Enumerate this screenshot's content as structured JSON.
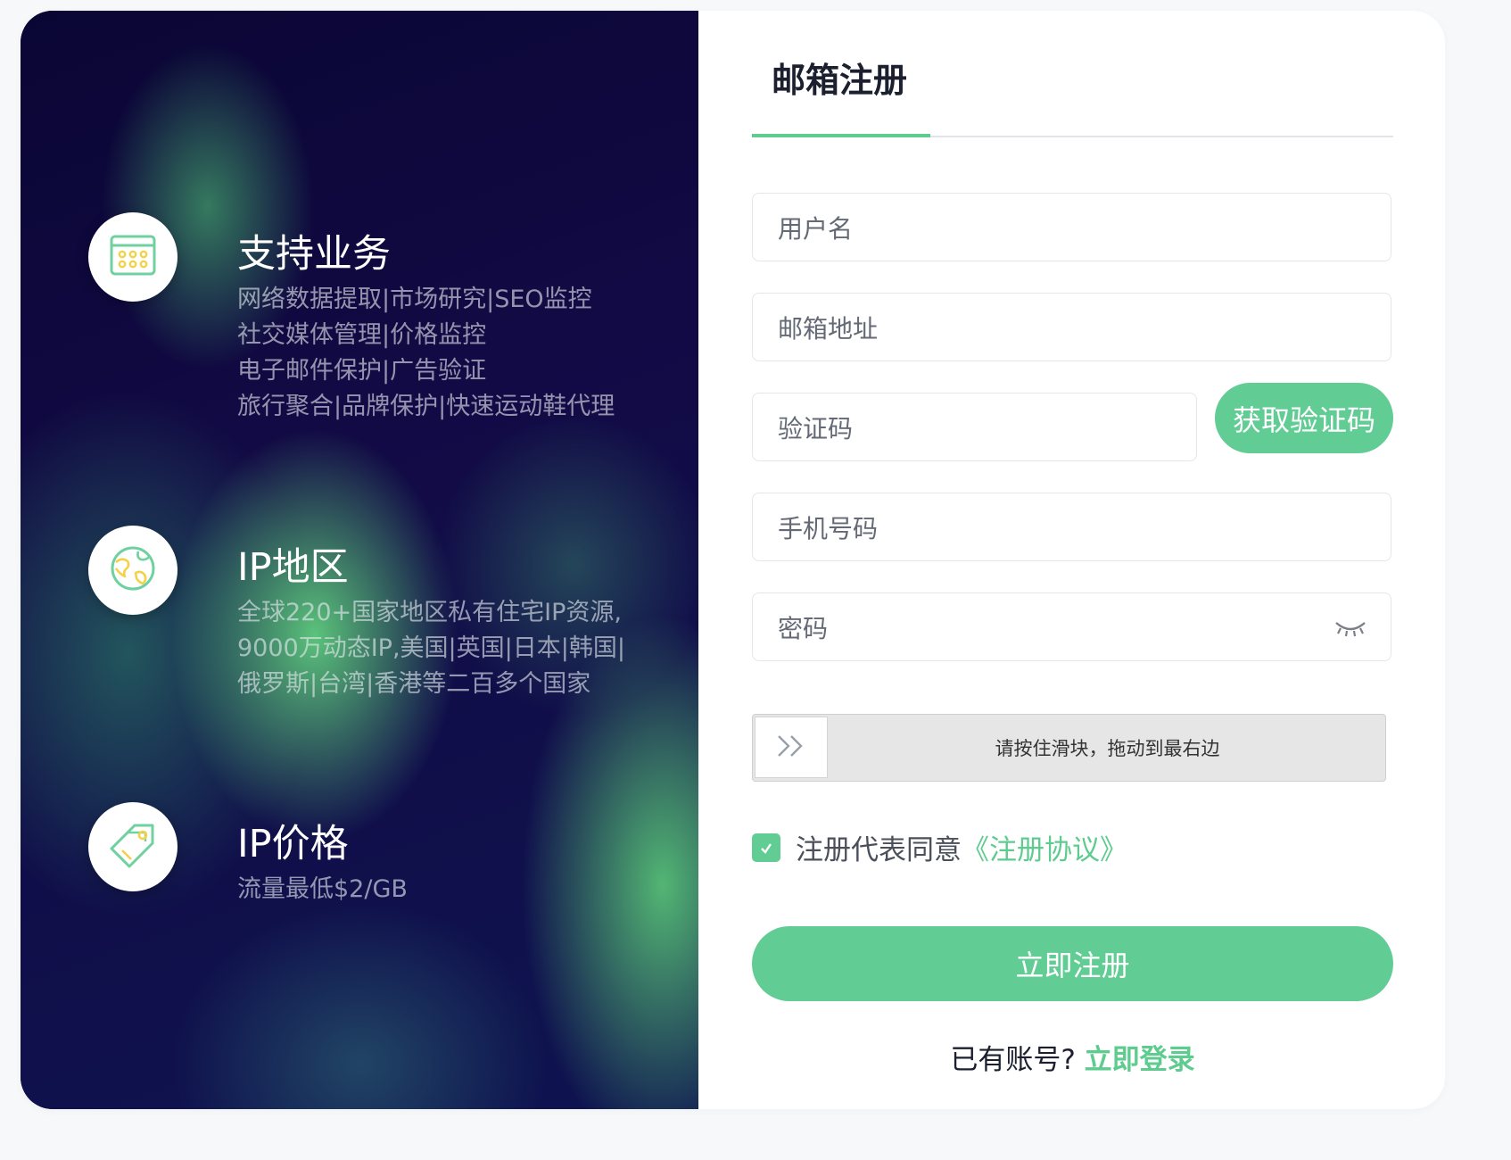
{
  "features": [
    {
      "icon": "calendar-grid-icon",
      "title": "支持业务",
      "lines": [
        "网络数据提取|市场研究|SEO监控",
        "社交媒体管理|价格监控",
        "电子邮件保护|广告验证",
        "旅行聚合|品牌保护|快速运动鞋代理"
      ]
    },
    {
      "icon": "globe-icon",
      "title": "IP地区",
      "lines": [
        "全球220+国家地区私有住宅IP资源,",
        "9000万动态IP,美国|英国|日本|韩国|",
        "俄罗斯|台湾|香港等二百多个国家"
      ]
    },
    {
      "icon": "price-tag-icon",
      "title": "IP价格",
      "lines": [
        "流量最低$2/GB"
      ]
    }
  ],
  "form": {
    "tab_title": "邮箱注册",
    "username_placeholder": "用户名",
    "email_placeholder": "邮箱地址",
    "code_placeholder": "验证码",
    "get_code_label": "获取验证码",
    "phone_placeholder": "手机号码",
    "password_placeholder": "密码",
    "slider_hint": "请按住滑块，拖动到最右边",
    "agree_text": "注册代表同意",
    "agree_link": "《注册协议》",
    "agree_checked": true,
    "submit_label": "立即注册",
    "login_prompt": "已有账号?",
    "login_link": "立即登录"
  },
  "colors": {
    "accent": "#62cc95",
    "left_panel_dark": "#0c0838"
  }
}
